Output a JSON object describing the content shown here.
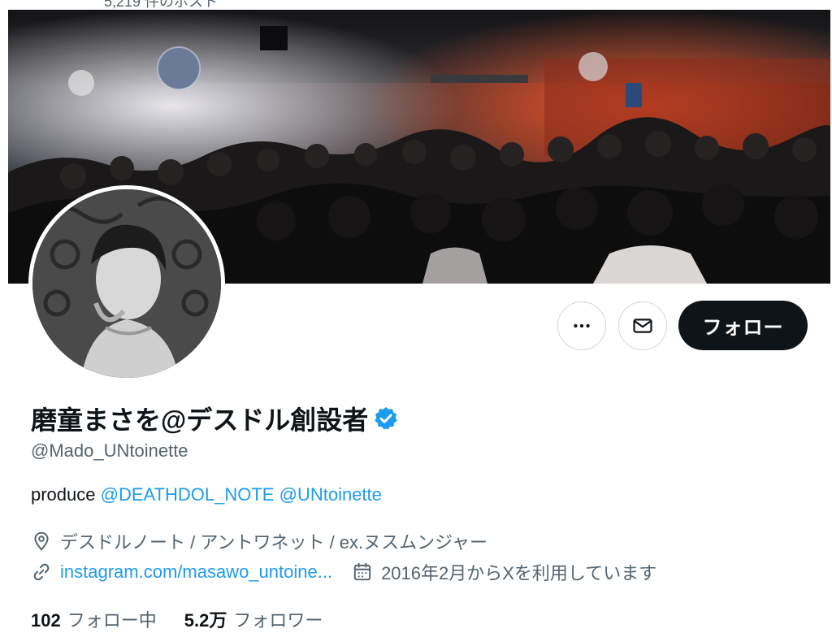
{
  "topbar": {
    "post_count_partial": "5,219 件のポスト"
  },
  "profile": {
    "display_name": "磨童まさを@デスドル創設者",
    "handle": "@Mado_UNtoinette",
    "bio": {
      "prefix": "produce ",
      "mention1": "@DEATHDOL_NOTE",
      "mention2": "@UNtoinette"
    },
    "location": "デスドルノート / アントワネット / ex.ヌスムンジャー",
    "website": "instagram.com/masawo_untoine...",
    "joined": "2016年2月からXを利用しています"
  },
  "actions": {
    "more_icon": "more-dots-icon",
    "message_icon": "mail-icon",
    "follow_label": "フォロー"
  },
  "stats": {
    "following_count": "102",
    "following_label": "フォロー中",
    "followers_count": "5.2万",
    "followers_label": "フォロワー"
  },
  "colors": {
    "accent": "#1d9bf0",
    "text": "#0f1419",
    "muted": "#536471",
    "border": "#cfd9de",
    "follow_bg": "#0f1419"
  }
}
